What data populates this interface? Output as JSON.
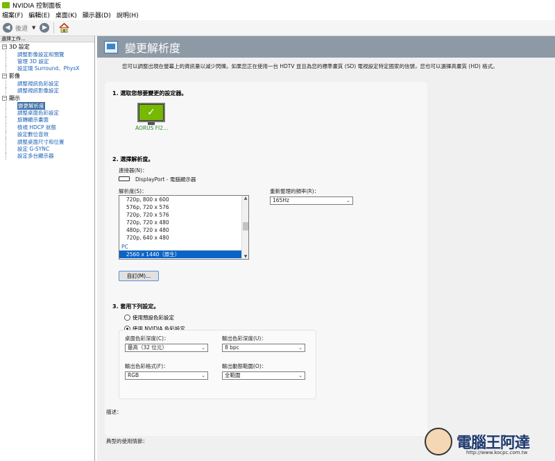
{
  "window": {
    "title": "NVIDIA 控制面板"
  },
  "menu": [
    "檔案(F)",
    "編輯(E)",
    "桌面(K)",
    "顯示器(D)",
    "說明(H)"
  ],
  "toolbar": {
    "back_label": "後退"
  },
  "sidebar": {
    "task_label": "選擇工作...",
    "categories": [
      {
        "label": "3D 設定",
        "items": [
          "調整影像設定和預覽",
          "管理 3D 設定",
          "設定環 Surround、PhysX"
        ]
      },
      {
        "label": "影像",
        "items": [
          "調整視訊色彩設定",
          "調整視訊影像設定"
        ]
      },
      {
        "label": "顯示",
        "items": [
          "變更解析度",
          "調整桌面色彩設定",
          "旋轉顯示畫面",
          "檢視 HDCP 狀態",
          "設定數位音效",
          "調整桌面尺寸和位置",
          "設定 G-SYNC",
          "設定多台顯示器"
        ]
      }
    ],
    "selected_item": "變更解析度"
  },
  "page": {
    "title": "變更解析度",
    "description": "您可以調整出現在螢幕上的資訊量以減少閃爍。如果您正在使用一台 HDTV 並且為您的標準畫質 (SD) 電視設定特定國家的信號，您也可以選擇高畫質 (HD) 格式。",
    "section1": {
      "title": "1. 選取您想要變更的設定器。",
      "monitor_label": "AORUS FI2..."
    },
    "section2": {
      "title": "2. 選擇解析度。",
      "connector_label": "連接器(N)：",
      "connector_value": "DisplayPort - 電腦顯示器",
      "resolution_label": "解析度(S)：",
      "resolution_rows": [
        "720p, 800 x 600",
        "576p, 720 x 576",
        "720p, 720 x 576",
        "720p, 720 x 480",
        "480p, 720 x 480",
        "720p, 640 x 480"
      ],
      "resolution_group": "PC",
      "resolution_selected": "2560 x 1440（原生）",
      "refresh_label": "重新整理的頻率(R)：",
      "refresh_value": "165Hz",
      "custom_button": "自訂(M)..."
    },
    "section3": {
      "title": "3. 套用下列設定。",
      "radio_default": "使用預設色彩設定",
      "radio_nvidia": "使用 NVIDIA 色彩設定",
      "desktop_color_depth_label": "桌面色彩深度(C)：",
      "desktop_color_depth_value": "最高（32 位元）",
      "output_color_depth_label": "輸出色彩深度(U)：",
      "output_color_depth_value": "8 bpc",
      "output_color_format_label": "輸出色彩格式(F)：",
      "output_color_format_value": "RGB",
      "output_dynamic_range_label": "輸出動態範圍(O)：",
      "output_dynamic_range_value": "全範圍"
    },
    "description_label": "描述：",
    "typical_usage_label": "典型的使用情節："
  },
  "watermark": {
    "text": "電腦王阿達",
    "url": "http://www.kocpc.com.tw"
  }
}
